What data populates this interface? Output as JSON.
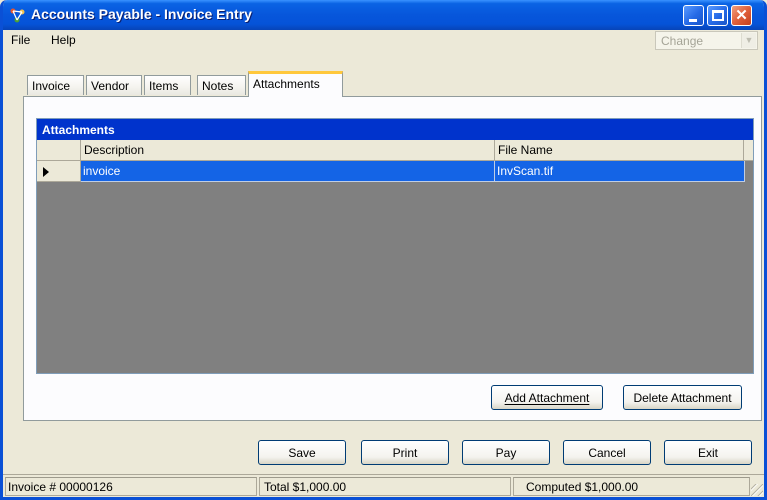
{
  "window": {
    "title": "Accounts Payable - Invoice Entry",
    "title_icon": "app-network-icon",
    "controls": [
      "minimize-icon",
      "maximize-icon",
      "close-icon"
    ]
  },
  "menu": {
    "file": "File",
    "help": "Help",
    "change_select": {
      "value": "Change",
      "disabled": true
    }
  },
  "tabs": [
    {
      "label": "Invoice",
      "active": false
    },
    {
      "label": "Vendor",
      "active": false
    },
    {
      "label": "Items",
      "active": false
    },
    {
      "label": "Notes",
      "active": false
    },
    {
      "label": "Attachments",
      "active": true
    }
  ],
  "attachments": {
    "caption": "Attachments",
    "columns": [
      "Description",
      "File Name"
    ],
    "rows": [
      {
        "description": "invoice",
        "file_name": "InvScan.tif",
        "selected": true
      }
    ],
    "add_button": "Add Attachment",
    "delete_button": "Delete Attachment"
  },
  "actions": {
    "save": "Save",
    "print": "Print",
    "pay": "Pay",
    "cancel": "Cancel",
    "exit": "Exit"
  },
  "status": {
    "invoice": "Invoice # 00000126",
    "total": "Total $1,000.00",
    "computed": "Computed $1,000.00"
  },
  "colors": {
    "titlebar": "#0756DB",
    "grid_caption": "#0033CC",
    "selected_row": "#1464E6",
    "grid_background": "#808080",
    "active_tab_highlight": "#FFC83C"
  }
}
